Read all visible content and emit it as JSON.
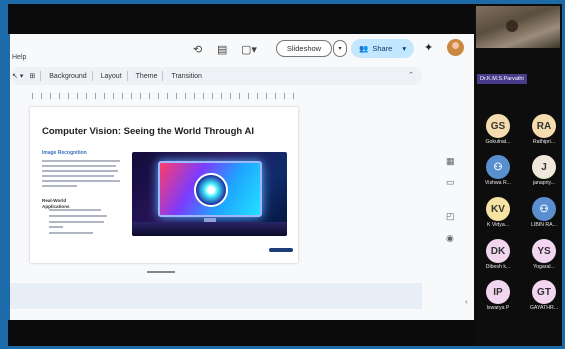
{
  "header": {
    "help_label": "Help",
    "slideshow_label": "Slideshow",
    "share_label": "Share"
  },
  "toolbar": {
    "background_label": "Background",
    "layout_label": "Layout",
    "theme_label": "Theme",
    "transition_label": "Transition"
  },
  "slide": {
    "title": "Computer Vision: Seeing the World Through AI",
    "subtitle": "Image Recognition",
    "section_heading": "Real-World Applications"
  },
  "gallery": {
    "presenter_label": "Dr.K.M.S.Parvathi",
    "participants": [
      {
        "initials": "GS",
        "name": "Gokulnat...",
        "color": "#f5dcae"
      },
      {
        "initials": "RA",
        "name": "Rathipri...",
        "color": "#f5dcae"
      },
      {
        "initials": "",
        "name": "Vishwa R...",
        "color": "#5a8fcf"
      },
      {
        "initials": "J",
        "name": "janapriy...",
        "color": "#f0e8dc"
      },
      {
        "initials": "KV",
        "name": "K Vidya...",
        "color": "#f4e3a3"
      },
      {
        "initials": "",
        "name": "LIBIN RA...",
        "color": "#5a8fcf"
      },
      {
        "initials": "DK",
        "name": "Dibesh k...",
        "color": "#f2d6f0"
      },
      {
        "initials": "YS",
        "name": "Yogaral...",
        "color": "#f2d6f0"
      },
      {
        "initials": "IP",
        "name": "Iswarya P",
        "color": "#f2d6f0"
      },
      {
        "initials": "GT",
        "name": "GAYATHR...",
        "color": "#f2d6f0"
      }
    ]
  }
}
